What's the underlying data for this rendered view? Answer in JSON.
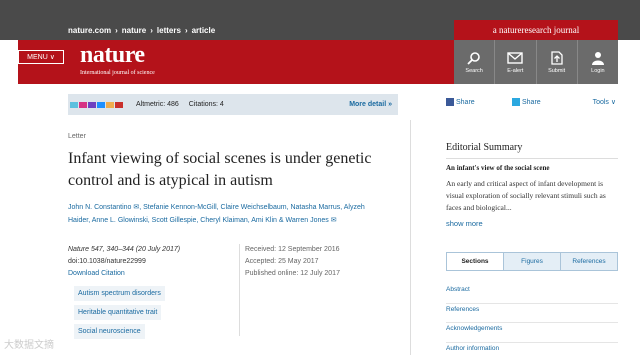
{
  "breadcrumb": [
    "nature.com",
    "nature",
    "letters",
    "article"
  ],
  "journal_badge": "a natureresearch journal",
  "header": {
    "menu_label": "MENU",
    "logo": "nature",
    "logo_sub": "International journal of science",
    "icons": [
      {
        "label": "Search",
        "icon": "search-icon"
      },
      {
        "label": "E-alert",
        "icon": "mail-icon"
      },
      {
        "label": "Submit",
        "icon": "upload-icon"
      },
      {
        "label": "Login",
        "icon": "user-icon"
      }
    ]
  },
  "metrics": {
    "altmetric": "Altmetric: 486",
    "citations": "Citations: 4",
    "more_detail": "More detail »",
    "swatch_colors": [
      "#5bc0de",
      "#d63384",
      "#6f42c1",
      "#1e90ff",
      "#f0ad4e",
      "#c9302c"
    ]
  },
  "share": {
    "facebook": "Share",
    "twitter": "Share",
    "tools": "Tools ∨"
  },
  "article": {
    "type": "Letter",
    "title": "Infant viewing of social scenes is under genetic control and is atypical in autism",
    "authors_line1": "John N. Constantino ✉, Stefanie Kennon-McGill, Claire Weichselbaum, Natasha Marrus, Alyzeh",
    "authors_line2": "Haider, Anne L. Glowinski, Scott Gillespie, Cheryl Klaiman, Ami Klin & Warren Jones ✉",
    "citation": "Nature 547, 340–344 (20 July 2017)",
    "doi": "doi:10.1038/nature22999",
    "download": "Download Citation",
    "received": "Received: 12 September 2016",
    "accepted": "Accepted: 25 May 2017",
    "published": "Published online: 12 July 2017",
    "tags": [
      "Autism spectrum disorders",
      "Heritable quantitative trait",
      "Social neuroscience"
    ]
  },
  "editorial": {
    "title": "Editorial Summary",
    "headline": "An infant's view of the social scene",
    "body": "An early and critical aspect of infant development is visual exploration of socially relevant stimuli such as faces and biological...",
    "show_more": "show more"
  },
  "tabs": [
    "Sections",
    "Figures",
    "References"
  ],
  "side_links": [
    "Abstract",
    "References",
    "Acknowledgements",
    "Author information"
  ],
  "watermark": "大数据文摘"
}
